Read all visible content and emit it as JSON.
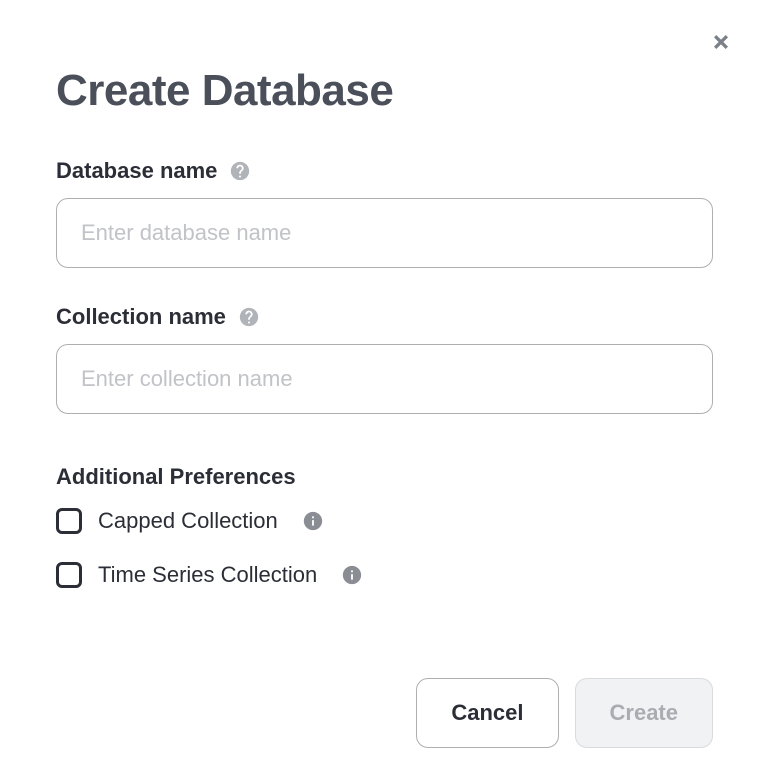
{
  "title": "Create Database",
  "fields": {
    "database": {
      "label": "Database name",
      "placeholder": "Enter database name",
      "value": ""
    },
    "collection": {
      "label": "Collection name",
      "placeholder": "Enter collection name",
      "value": ""
    }
  },
  "preferences": {
    "header": "Additional Preferences",
    "capped": {
      "label": "Capped Collection",
      "checked": false
    },
    "timeseries": {
      "label": "Time Series Collection",
      "checked": false
    }
  },
  "buttons": {
    "cancel": "Cancel",
    "create": "Create"
  }
}
